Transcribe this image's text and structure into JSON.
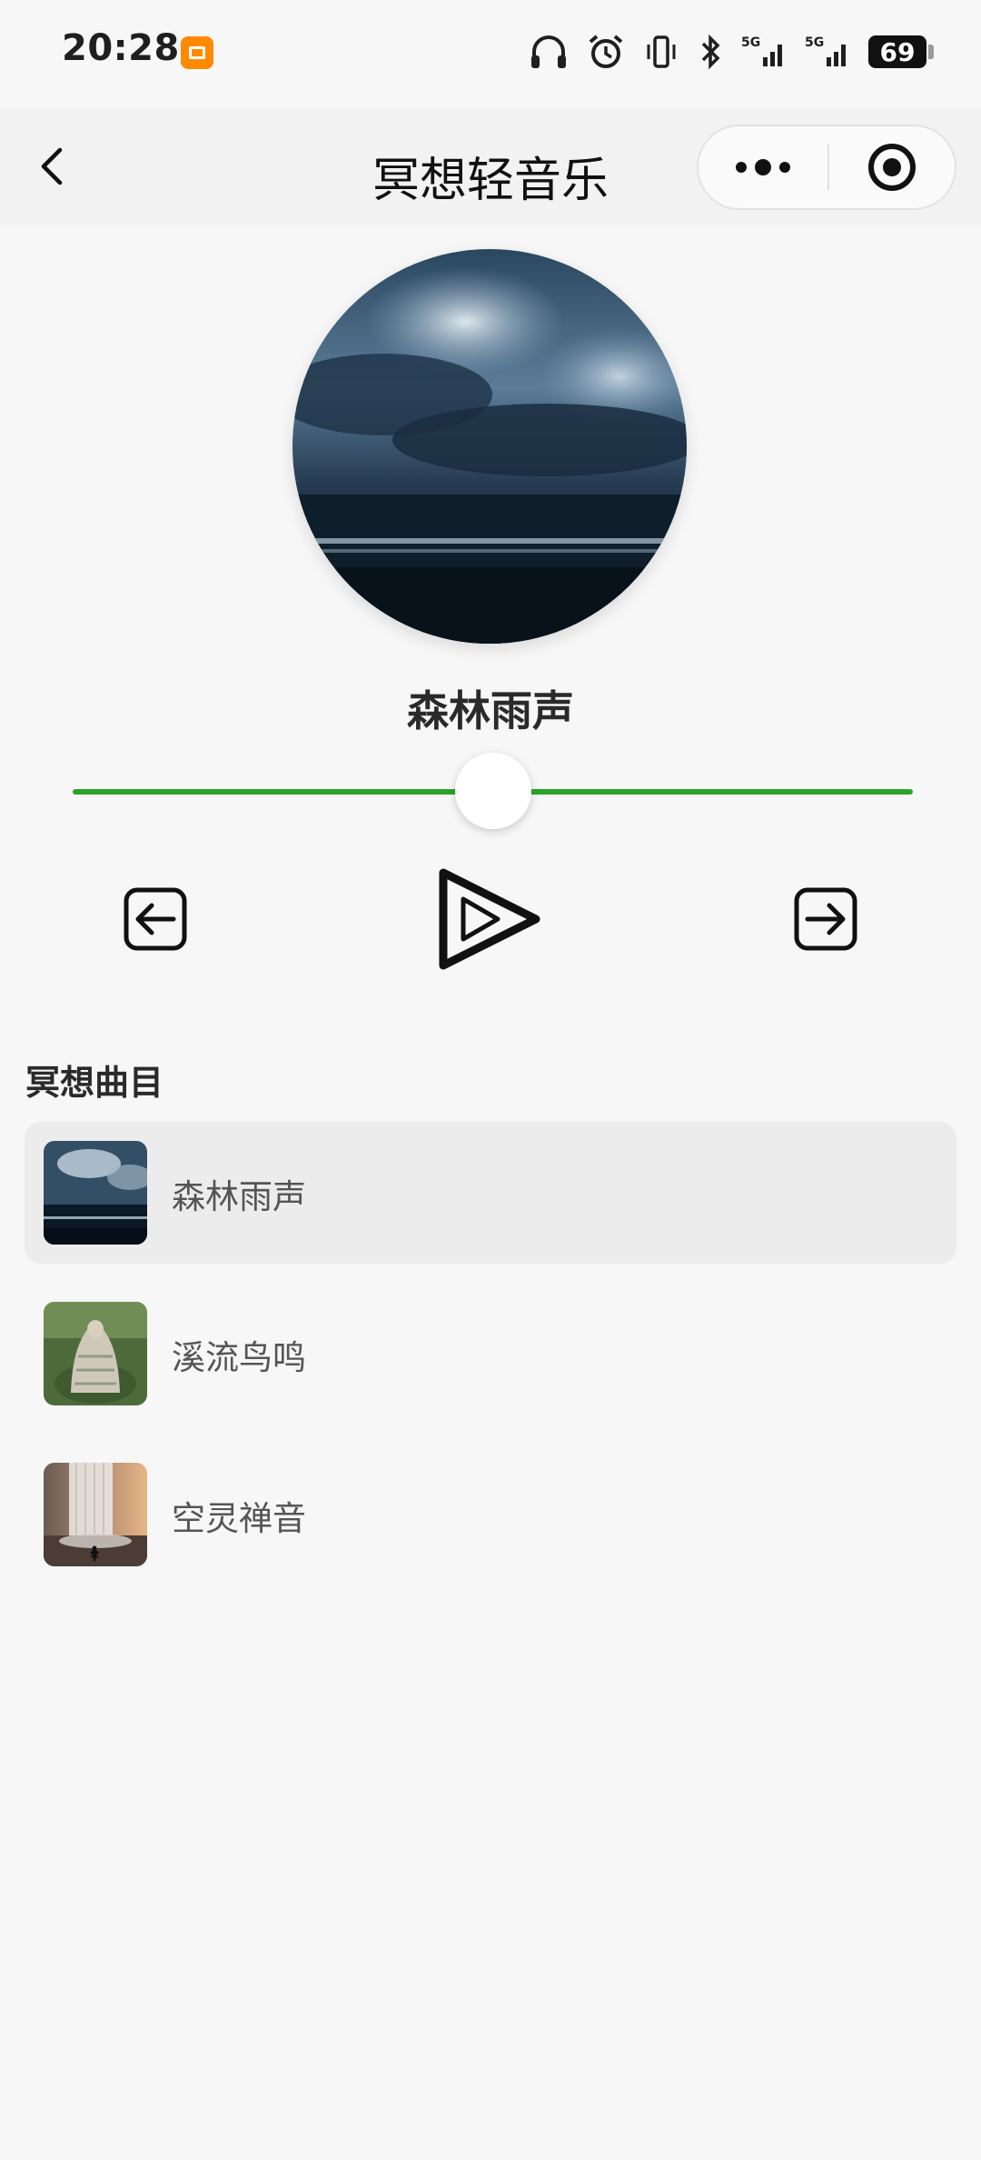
{
  "status_bar": {
    "time": "20:28",
    "battery": "69",
    "icons": [
      "app-notification-icon",
      "headphones-icon",
      "alarm-icon",
      "vibrate-icon",
      "bluetooth-icon",
      "signal-5g-icon",
      "signal-5g-icon",
      "battery-icon"
    ]
  },
  "nav": {
    "title": "冥想轻音乐",
    "back_icon": "chevron-left-icon",
    "more_icon": "more-dots-icon",
    "close_icon": "target-close-icon"
  },
  "player": {
    "current_title": "森林雨声",
    "progress": 0.5,
    "accent_color": "#2aa52a",
    "controls": {
      "prev_icon": "arrow-left-box-icon",
      "play_icon": "play-triangle-icon",
      "next_icon": "arrow-right-box-icon"
    }
  },
  "playlist": {
    "heading": "冥想曲目",
    "items": [
      {
        "title": "森林雨声",
        "active": true,
        "thumb": "stormy-sea"
      },
      {
        "title": "溪流鸟鸣",
        "active": false,
        "thumb": "blanket-person-forest"
      },
      {
        "title": "空灵禅音",
        "active": false,
        "thumb": "waterfall"
      }
    ]
  }
}
